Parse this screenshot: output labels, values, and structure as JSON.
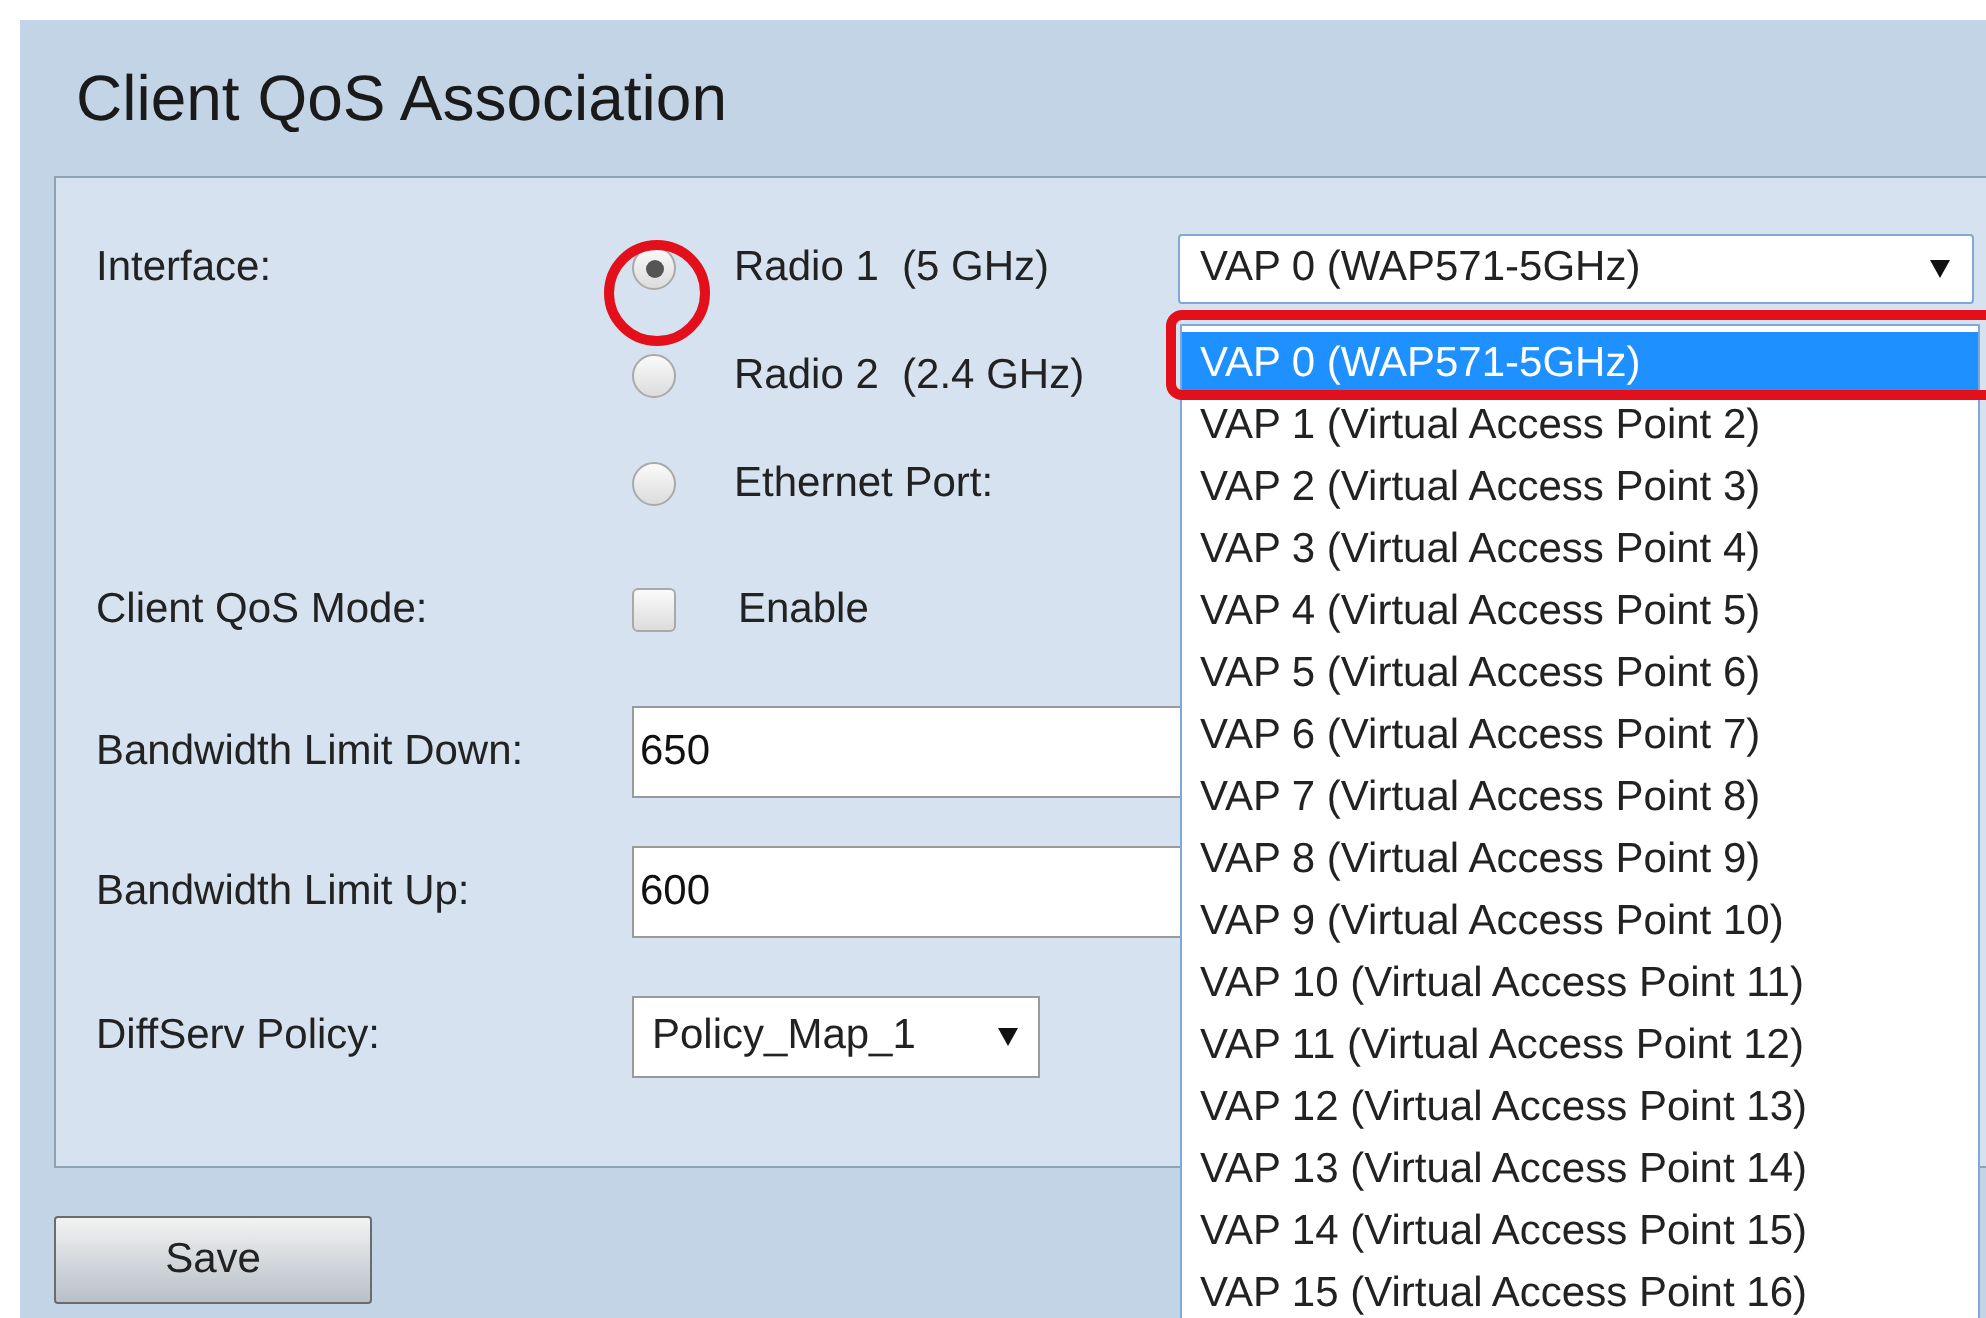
{
  "title": "Client QoS Association",
  "interface": {
    "label": "Interface:",
    "options": [
      {
        "label": "Radio 1  (5 GHz)",
        "selected": true
      },
      {
        "label": "Radio 2  (2.4 GHz)",
        "selected": false
      },
      {
        "label": "Ethernet Port:",
        "selected": false
      }
    ]
  },
  "vap_select": {
    "value": "VAP 0 (WAP571-5GHz)",
    "expanded": true,
    "options": [
      {
        "label": "VAP 0 (WAP571-5GHz)",
        "selected": true
      },
      {
        "label": "VAP 1 (Virtual Access Point 2)",
        "selected": false
      },
      {
        "label": "VAP 2 (Virtual Access Point 3)",
        "selected": false
      },
      {
        "label": "VAP 3 (Virtual Access Point 4)",
        "selected": false
      },
      {
        "label": "VAP 4 (Virtual Access Point 5)",
        "selected": false
      },
      {
        "label": "VAP 5 (Virtual Access Point 6)",
        "selected": false
      },
      {
        "label": "VAP 6 (Virtual Access Point 7)",
        "selected": false
      },
      {
        "label": "VAP 7 (Virtual Access Point 8)",
        "selected": false
      },
      {
        "label": "VAP 8 (Virtual Access Point 9)",
        "selected": false
      },
      {
        "label": "VAP 9 (Virtual Access Point 10)",
        "selected": false
      },
      {
        "label": "VAP 10 (Virtual Access Point 11)",
        "selected": false
      },
      {
        "label": "VAP 11 (Virtual Access Point 12)",
        "selected": false
      },
      {
        "label": "VAP 12 (Virtual Access Point 13)",
        "selected": false
      },
      {
        "label": "VAP 13 (Virtual Access Point 14)",
        "selected": false
      },
      {
        "label": "VAP 14 (Virtual Access Point 15)",
        "selected": false
      },
      {
        "label": "VAP 15 (Virtual Access Point 16)",
        "selected": false
      }
    ]
  },
  "client_qos_mode": {
    "label": "Client QoS Mode:",
    "option": "Enable",
    "checked": false
  },
  "bandwidth_limit_down": {
    "label": "Bandwidth Limit Down:",
    "value": "650"
  },
  "bandwidth_limit_up": {
    "label": "Bandwidth Limit Up:",
    "value": "600"
  },
  "diffserv_policy": {
    "label": "DiffServ Policy:",
    "value": "Policy_Map_1"
  },
  "save_button": "Save"
}
